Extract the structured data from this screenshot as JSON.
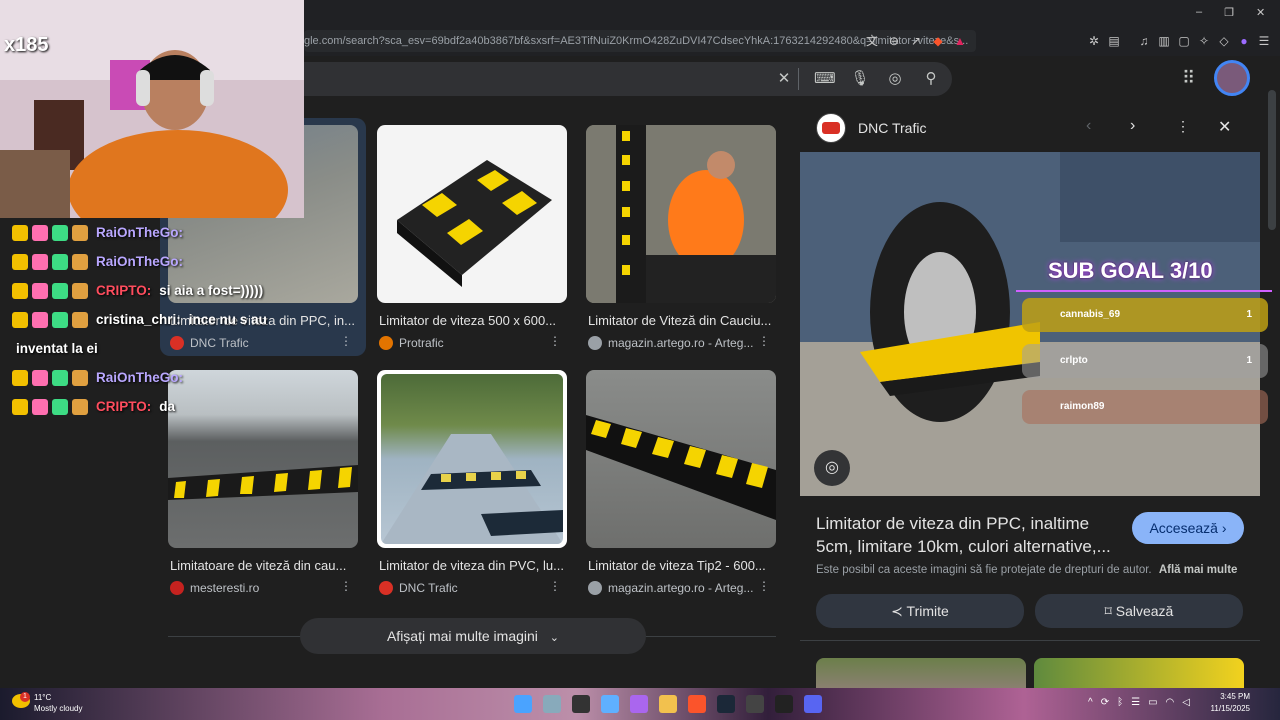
{
  "browser": {
    "url": "gle.com/search?sca_esv=69bdf2a40b3867bf&sxsrf=AE3TifNuiZ0KrmO428ZuDVI47CdsecYhkA:1763214292480&q=limitator+viteze&s...",
    "toolbar_icons": [
      "translate-icon",
      "zoom-icon",
      "share-icon",
      "brave-shield-icon",
      "brave-rewards-icon",
      "extensions-icon",
      "tab-icon",
      "music-icon",
      "sidebar-icon",
      "wallet-icon",
      "leo-icon",
      "vpn-icon",
      "proton-icon",
      "menu-icon"
    ]
  },
  "window_controls": {
    "minimize": "–",
    "restore": "❐",
    "close": "✕"
  },
  "search": {
    "clear_label": "✕",
    "icons": [
      "keyboard-icon",
      "mic-icon",
      "lens-icon",
      "search-icon"
    ]
  },
  "results": [
    {
      "title": "Limitator de viteza din PPC, in...",
      "source": "DNC Trafic",
      "fav": "#d93025"
    },
    {
      "title": "Limitator de viteza 500 x 600...",
      "source": "Protrafic",
      "fav": "#e37400"
    },
    {
      "title": "Limitator de Viteză din Cauciu...",
      "source": "magazin.artego.ro - Arteg...",
      "fav": "#9aa0a6"
    },
    {
      "title": "Limitatoare de viteză din cau...",
      "source": "mesteresti.ro",
      "fav": "#c5221f"
    },
    {
      "title": "Limitator de viteza din PVC, lu...",
      "source": "DNC Trafic",
      "fav": "#d93025"
    },
    {
      "title": "Limitator de viteza Tip2 - 600...",
      "source": "magazin.artego.ro - Arteg...",
      "fav": "#9aa0a6"
    }
  ],
  "more_images": "Afișați mai multe imagini",
  "panel": {
    "site": "DNC Trafic",
    "title": "Limitator de viteza din PPC, inaltime 5cm, limitare 10km, culori alternative,...",
    "visit": "Accesează",
    "copyright": "Este posibil ca aceste imagini să fie protejate de drepturi de autor.",
    "learn_more": "Află mai multe",
    "share": "Trimite",
    "save": "Salvează"
  },
  "stream": {
    "counter": "x185",
    "sub_goal": "SUB GOAL 3/10",
    "goal_rows": [
      {
        "name": "cannabis_69",
        "count": "1"
      },
      {
        "name": "crlpto",
        "count": "1"
      },
      {
        "name": "raimon89",
        "count": ""
      }
    ],
    "chat": [
      {
        "user": "RaiOnTheGo:",
        "text": "",
        "color": "#b9a7ff"
      },
      {
        "user": "RaiOnTheGo:",
        "text": "",
        "color": "#b9a7ff"
      },
      {
        "user": "CRIPTO:",
        "text": "si aia a fost=)))))",
        "color": "#ff4d5e"
      },
      {
        "user": "cristina_chri:",
        "text": "ince nu s au",
        "color": "#ffffff"
      },
      {
        "user": "",
        "text": "inventat la ei",
        "color": "#ffffff"
      },
      {
        "user": "RaiOnTheGo:",
        "text": "",
        "color": "#b9a7ff"
      },
      {
        "user": "CRIPTO:",
        "text": "da",
        "color": "#ff4d5e"
      }
    ]
  },
  "taskbar": {
    "weather_temp": "11°C",
    "weather_desc": "Mostly cloudy",
    "notification_count": "1",
    "time": "3:45 PM",
    "date": "11/15/2025"
  }
}
